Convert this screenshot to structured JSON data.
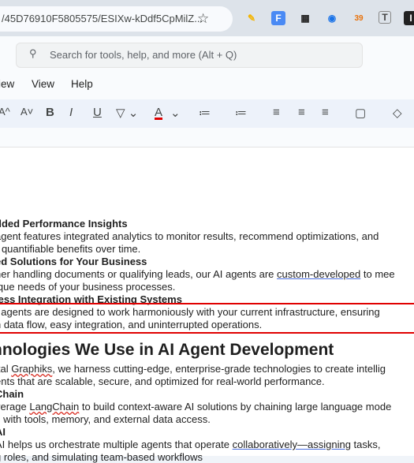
{
  "browser": {
    "url_text": "/45D76910F5805575/ESIXw-kDdf5CpMilZ...",
    "star": "☆",
    "extensions": [
      "✎",
      "F",
      "▦",
      "◉",
      "39",
      "T",
      "I"
    ]
  },
  "docs": {
    "search_placeholder": "Search for tools, help, and more (Alt + Q)",
    "menu": [
      "iew",
      "View",
      "Help"
    ],
    "toolbar": [
      "A^",
      "A˅",
      "B",
      "I",
      "U",
      "A",
      "≔",
      "≔",
      "≡",
      "≡",
      "≡",
      "▢",
      "◇"
    ]
  },
  "content": {
    "l1": "dded Performance Insights",
    "l2": "agent features integrated analytics to monitor results, recommend optimizations, and",
    "l3": "r quantifiable benefits over time.",
    "l4": "ed Solutions for Your Business",
    "l5a": "her handling documents or qualifying leads, our AI agents are ",
    "l5b": "custom-developed",
    "l5c": " to mee",
    "l6": "ique needs of your business processes.",
    "l7": "less Integration with Existing Systems",
    "l8": "I agents are designed to work harmoniously with your current infrastructure, ensuring",
    "l9": "h data flow, easy integration, and uninterrupted operations.",
    "h2": "hnologies We Use in AI Agent Development",
    "l10a": "ital ",
    "l10b": "Graphiks",
    "l10c": ", we harness cutting-edge, enterprise-grade technologies to create intellig",
    "l11": "ents that are scalable, secure, and optimized for real-world performance.",
    "l12": "Chain",
    "l13a": "verage ",
    "l13b": "LangChain",
    "l13c": " to build context-aware AI solutions by chaining large language mode",
    "l14": "s with tools, memory, and external data access.",
    "l15": "AI",
    "l16a": "AI helps us orchestrate multiple agents that operate ",
    "l16b": "collaboratively—assigning",
    "l16c": " tasks,",
    "l17": "g roles, and simulating team-based workflows"
  }
}
